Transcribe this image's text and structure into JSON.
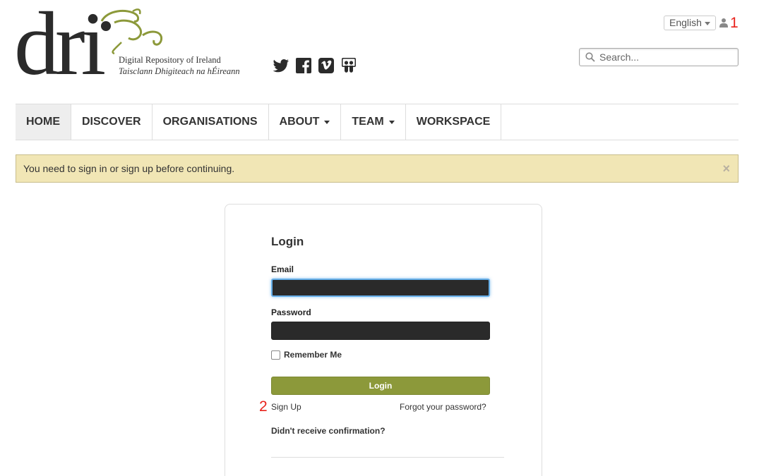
{
  "header": {
    "logo_word": "dri",
    "tagline_en": "Digital Repository of Ireland",
    "tagline_ga": "Taisclann Dhigiteach na hÉireann",
    "social_icons": [
      "twitter-icon",
      "facebook-icon",
      "vimeo-icon",
      "slideshare-icon"
    ],
    "language": "English",
    "user_icon": "user-icon",
    "search_placeholder": "Search..."
  },
  "annotations": {
    "marker_1": "1",
    "marker_2": "2"
  },
  "nav": {
    "items": [
      {
        "label": "HOME",
        "active": true,
        "dropdown": false
      },
      {
        "label": "DISCOVER",
        "active": false,
        "dropdown": false
      },
      {
        "label": "ORGANISATIONS",
        "active": false,
        "dropdown": false
      },
      {
        "label": "ABOUT",
        "active": false,
        "dropdown": true
      },
      {
        "label": "TEAM",
        "active": false,
        "dropdown": true
      },
      {
        "label": "WORKSPACE",
        "active": false,
        "dropdown": false
      }
    ]
  },
  "alert": {
    "message": "You need to sign in or sign up before continuing.",
    "close": "×"
  },
  "login": {
    "title": "Login",
    "email_label": "Email",
    "email_value": "",
    "password_label": "Password",
    "password_value": "",
    "remember_label": "Remember Me",
    "remember_checked": false,
    "submit_label": "Login",
    "signup_link": "Sign Up",
    "forgot_link": "Forgot your password?",
    "confirmation_link": "Didn't receive confirmation?"
  },
  "colors": {
    "brand_green": "#8c993a",
    "alert_bg": "#f1e6b5",
    "annotation_red": "#e8221c",
    "logo_dark": "#2b2b2b"
  }
}
